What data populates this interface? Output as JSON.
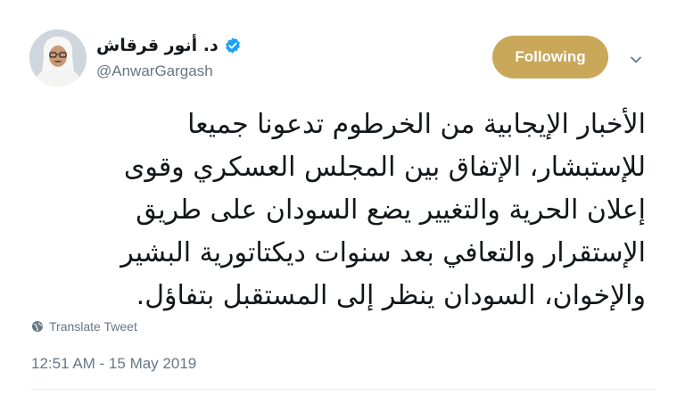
{
  "profile": {
    "display_name": "د. أنور قرقاش",
    "handle": "@AnwarGargash",
    "verified": true
  },
  "header": {
    "follow_label": "Following"
  },
  "tweet": {
    "lines": [
      "الأخبار الإيجابية من الخرطوم تدعونا جميعا",
      "للإستبشار، الإتفاق بين المجلس العسكري وقوى",
      "إعلان الحرية والتغيير يضع السودان على طريق",
      "الإستقرار والتعافي بعد سنوات ديكتاتورية البشير",
      "والإخوان، السودان ينظر إلى المستقبل بتفاؤل."
    ],
    "translate_label": "Translate Tweet",
    "timestamp": "12:51 AM - 15 May 2019"
  },
  "colors": {
    "follow_button": "#c9a85a",
    "verified_badge": "#1da1f2",
    "secondary_text": "#657786"
  },
  "icons": {
    "verified": "verified-badge-icon",
    "caret": "chevron-down-icon",
    "translate": "globe-icon"
  }
}
